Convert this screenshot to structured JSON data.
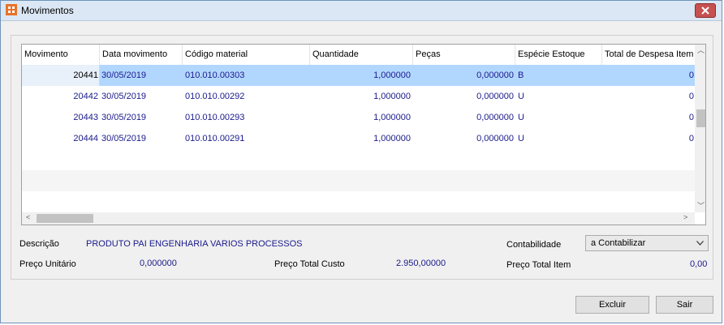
{
  "window": {
    "title": "Movimentos"
  },
  "grid": {
    "columns": [
      "Movimento",
      "Data movimento",
      "Código material",
      "Quantidade",
      "Peças",
      "Espécie Estoque",
      "Total de Despesa Item"
    ],
    "rows": [
      {
        "movimento": "20441",
        "data": "30/05/2019",
        "codigo": "010.010.00303",
        "quantidade": "1,000000",
        "pecas": "0,000000",
        "especie": "B",
        "total": "0"
      },
      {
        "movimento": "20442",
        "data": "30/05/2019",
        "codigo": "010.010.00292",
        "quantidade": "1,000000",
        "pecas": "0,000000",
        "especie": "U",
        "total": "0"
      },
      {
        "movimento": "20443",
        "data": "30/05/2019",
        "codigo": "010.010.00293",
        "quantidade": "1,000000",
        "pecas": "0,000000",
        "especie": "U",
        "total": "0"
      },
      {
        "movimento": "20444",
        "data": "30/05/2019",
        "codigo": "010.010.00291",
        "quantidade": "1,000000",
        "pecas": "0,000000",
        "especie": "U",
        "total": "0"
      }
    ]
  },
  "details": {
    "descricao_label": "Descrição",
    "descricao_value": "PRODUTO PAI ENGENHARIA VARIOS PROCESSOS",
    "preco_unitario_label": "Preço Unitário",
    "preco_unitario_value": "0,000000",
    "preco_total_custo_label": "Preço Total Custo",
    "preco_total_custo_value": "2.950,00000",
    "contabilidade_label": "Contabilidade",
    "contabilidade_value": "a Contabilizar",
    "preco_total_item_label": "Preço Total Item",
    "preco_total_item_value": "0,00"
  },
  "buttons": {
    "excluir": "Excluir",
    "sair": "Sair"
  },
  "colors": {
    "selection": "#b2d7ff",
    "value_text": "#1a1a8c",
    "titlebar": "#dbe7f4",
    "close": "#c75050"
  }
}
